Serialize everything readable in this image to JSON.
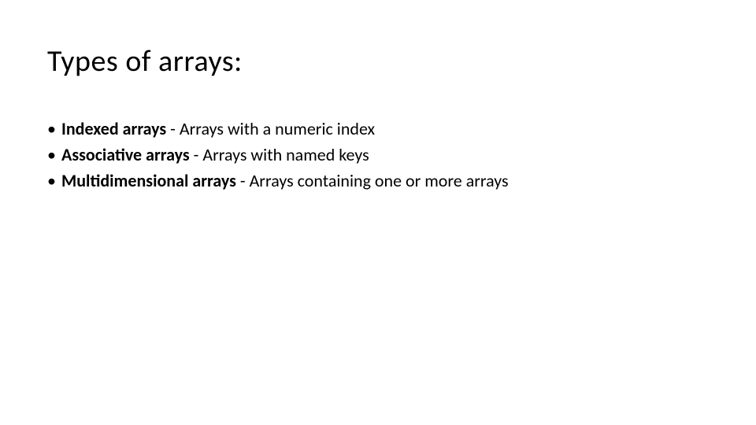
{
  "title": "Types of arrays:",
  "bullets": [
    {
      "term": "Indexed arrays",
      "desc": " - Arrays with a numeric index"
    },
    {
      "term": "Associative arrays",
      "desc": " - Arrays with named keys"
    },
    {
      "term": "Multidimensional arrays",
      "desc": " - Arrays containing one or more arrays"
    }
  ]
}
